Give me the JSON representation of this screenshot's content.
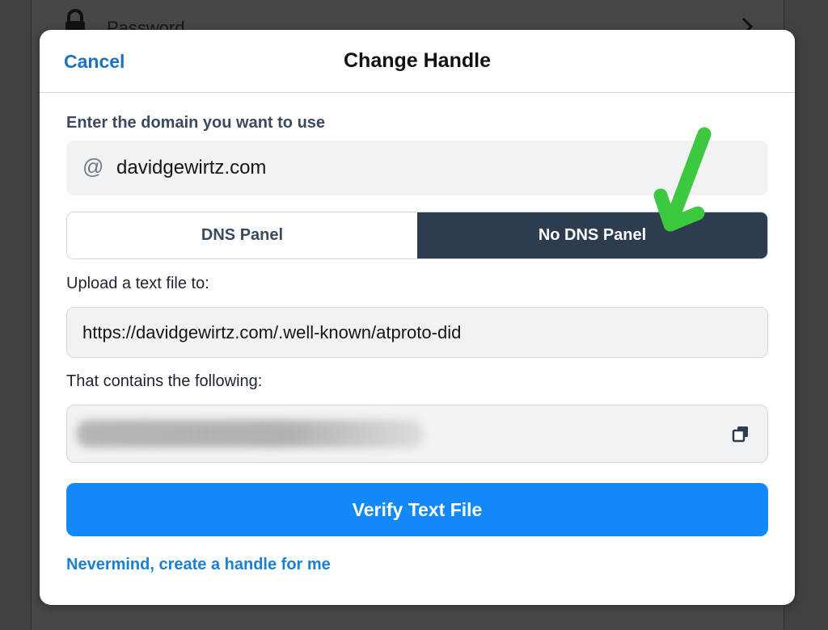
{
  "background": {
    "row_label": "Password",
    "icons": {
      "lock": "lock-icon",
      "chevron": "chevron-right-icon"
    }
  },
  "modal": {
    "cancel_label": "Cancel",
    "title": "Change Handle",
    "domain_label": "Enter the domain you want to use",
    "domain_icon": "at-sign-icon",
    "domain_value": "davidgewirtz.com",
    "segments": [
      {
        "label": "DNS Panel",
        "selected": false
      },
      {
        "label": "No DNS Panel",
        "selected": true
      }
    ],
    "upload_label": "Upload a text file to:",
    "upload_url": "https://davidgewirtz.com/.well-known/atproto-did",
    "contains_label": "That contains the following:",
    "contains_value_redacted": true,
    "copy_icon": "copy-icon",
    "verify_label": "Verify Text File",
    "nevermind_label": "Nevermind, create a handle for me"
  },
  "annotation": {
    "arrow_color": "#3dc93f"
  },
  "colors": {
    "accent": "#1389f7",
    "link": "#1a73c2",
    "segment_selected": "#2e3c4f"
  }
}
